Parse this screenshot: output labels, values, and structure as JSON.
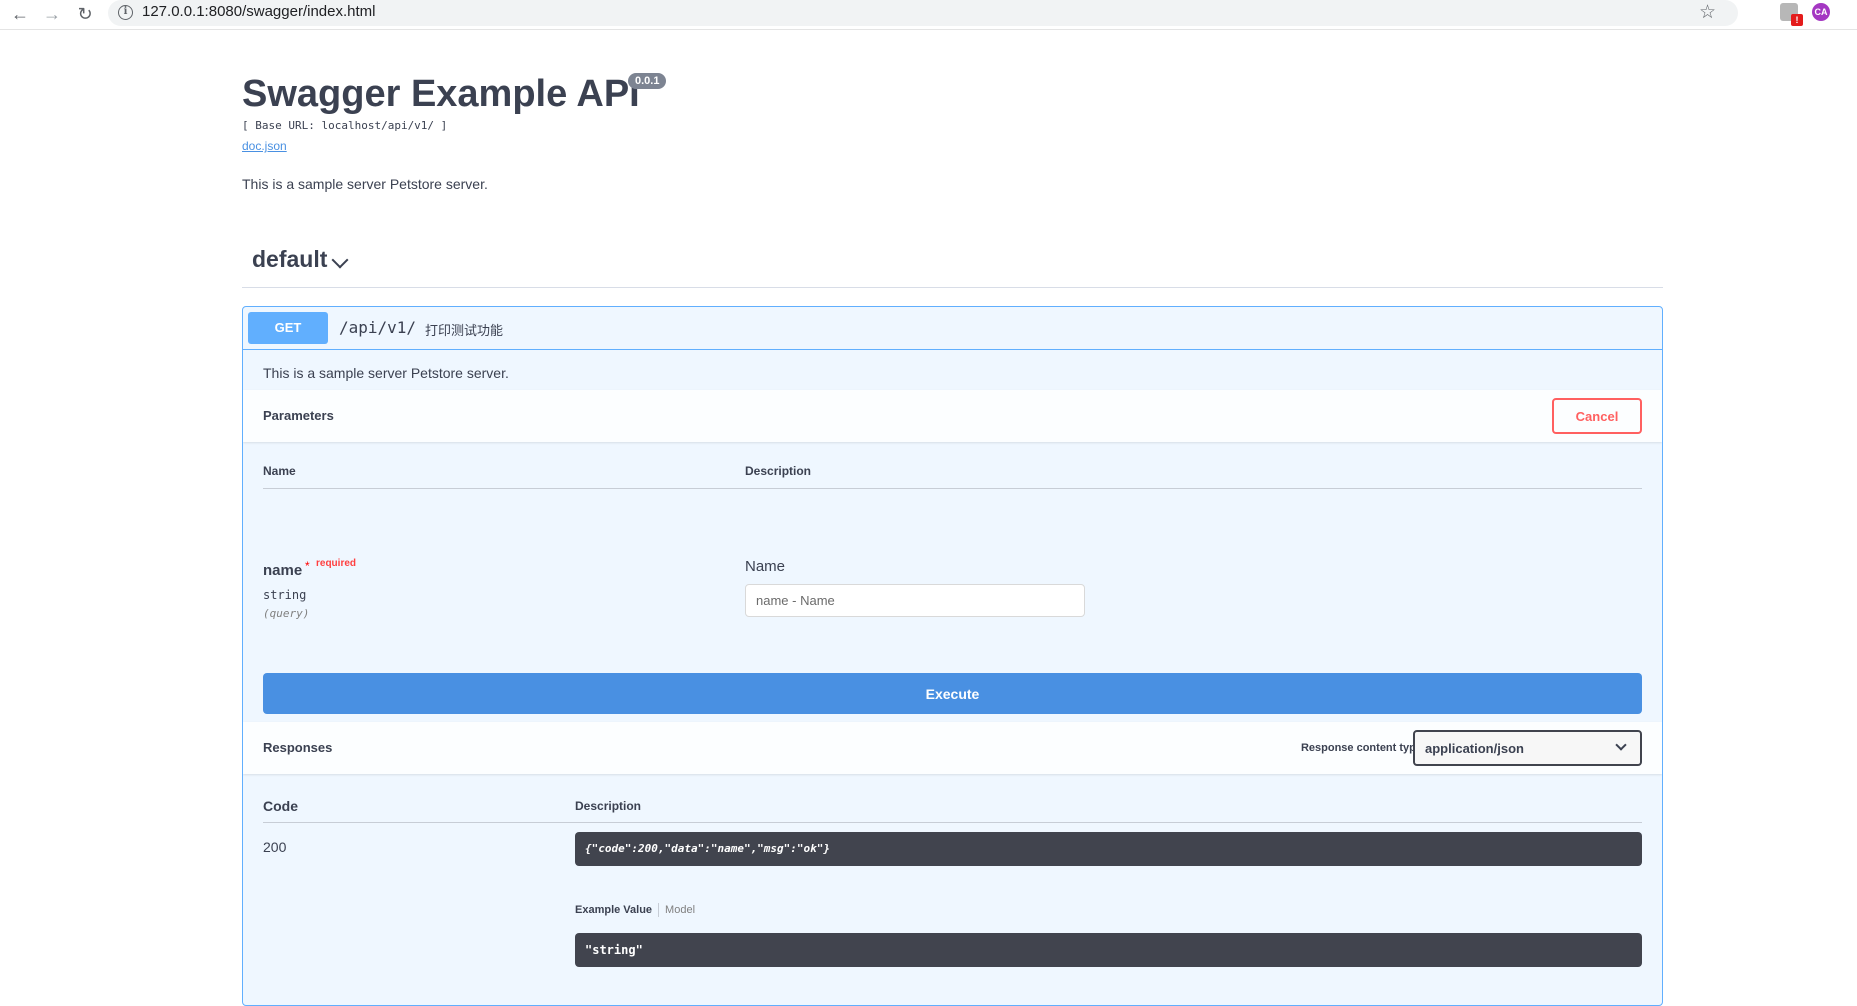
{
  "browser": {
    "url": "127.0.0.1:8080/swagger/index.html",
    "ext_badge": "!",
    "ext_avatar": "CA"
  },
  "info": {
    "title": "Swagger Example API",
    "version": "0.0.1",
    "base_url": "[ Base URL: localhost/api/v1/ ]",
    "doc_link": "doc.json",
    "description": "This is a sample server Petstore server."
  },
  "tag": {
    "name": "default"
  },
  "operation": {
    "method": "GET",
    "path": "/api/v1/",
    "summary": "打印测试功能",
    "description": "This is a sample server Petstore server.",
    "parameters_title": "Parameters",
    "cancel_label": "Cancel",
    "columns": {
      "name": "Name",
      "description": "Description"
    },
    "param": {
      "name": "name",
      "required_star": "*",
      "required_label": "required",
      "type": "string",
      "in": "(query)",
      "description": "Name",
      "placeholder": "name - Name"
    },
    "execute_label": "Execute",
    "responses_title": "Responses",
    "response_content_type_label": "Response content type",
    "response_content_type": "application/json",
    "response_columns": {
      "code": "Code",
      "description": "Description"
    },
    "response": {
      "code": "200",
      "description": "{\"code\":200,\"data\":\"name\",\"msg\":\"ok\"}",
      "example_tab": "Example Value",
      "model_tab": "Model",
      "example": "\"string\""
    }
  },
  "colors": {
    "get_method": "#61affe",
    "execute": "#4990e2",
    "cancel": "#ff6060",
    "code_bg": "#41444e"
  }
}
